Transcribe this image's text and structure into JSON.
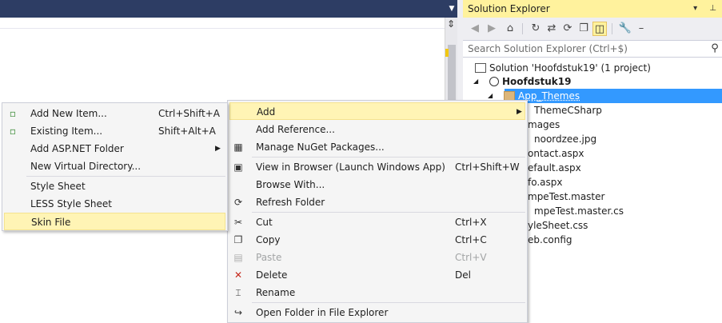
{
  "solution_explorer": {
    "title": "Solution Explorer",
    "title_controls": "▾ ⊥",
    "search_placeholder": "Search Solution Explorer (Ctrl+$)",
    "tree": [
      {
        "label": "Solution 'Hoofdstuk19' (1 project)"
      },
      {
        "label": "Hoofdstuk19"
      },
      {
        "label": "App_Themes"
      },
      {
        "label": "ThemeCSharp"
      },
      {
        "label": "mages"
      },
      {
        "label": "noordzee.jpg"
      },
      {
        "label": "ontact.aspx"
      },
      {
        "label": "efault.aspx"
      },
      {
        "label": "fo.aspx"
      },
      {
        "label": "mpeTest.master"
      },
      {
        "label": "mpeTest.master.cs"
      },
      {
        "label": "yleSheet.css"
      },
      {
        "label": "eb.config"
      }
    ]
  },
  "context_menu": {
    "items": [
      {
        "label": "Add",
        "shortcut": "",
        "icon": ""
      },
      {
        "label": "Add Reference...",
        "shortcut": "",
        "icon": ""
      },
      {
        "label": "Manage NuGet Packages...",
        "shortcut": "",
        "icon": "nuget-icon"
      },
      {
        "label": "View in Browser (Launch Windows App)",
        "shortcut": "Ctrl+Shift+W",
        "icon": "view-in-browser-icon"
      },
      {
        "label": "Browse With...",
        "shortcut": "",
        "icon": ""
      },
      {
        "label": "Refresh Folder",
        "shortcut": "",
        "icon": "refresh-icon"
      },
      {
        "label": "Cut",
        "shortcut": "Ctrl+X",
        "icon": "cut-icon"
      },
      {
        "label": "Copy",
        "shortcut": "Ctrl+C",
        "icon": "copy-icon"
      },
      {
        "label": "Paste",
        "shortcut": "Ctrl+V",
        "icon": "paste-icon"
      },
      {
        "label": "Delete",
        "shortcut": "Del",
        "icon": "delete-icon"
      },
      {
        "label": "Rename",
        "shortcut": "",
        "icon": "rename-icon"
      },
      {
        "label": "Open Folder in File Explorer",
        "shortcut": "",
        "icon": "open-folder-icon"
      }
    ]
  },
  "add_submenu": {
    "items": [
      {
        "label": "Add New Item...",
        "shortcut": "Ctrl+Shift+A",
        "icon": "add-new-item-icon"
      },
      {
        "label": "Existing Item...",
        "shortcut": "Shift+Alt+A",
        "icon": "add-existing-item-icon"
      },
      {
        "label": "Add ASP.NET Folder",
        "shortcut": "",
        "icon": ""
      },
      {
        "label": "New Virtual Directory...",
        "shortcut": "",
        "icon": ""
      },
      {
        "label": "Style Sheet",
        "shortcut": "",
        "icon": ""
      },
      {
        "label": "LESS Style Sheet",
        "shortcut": "",
        "icon": ""
      },
      {
        "label": "Skin File",
        "shortcut": "",
        "icon": ""
      }
    ]
  },
  "colors": {
    "accent_yellow": "#fff29d",
    "selection_blue": "#3399ff",
    "menu_highlight": "#fff4b5",
    "tab_strip": "#2d3d64"
  }
}
